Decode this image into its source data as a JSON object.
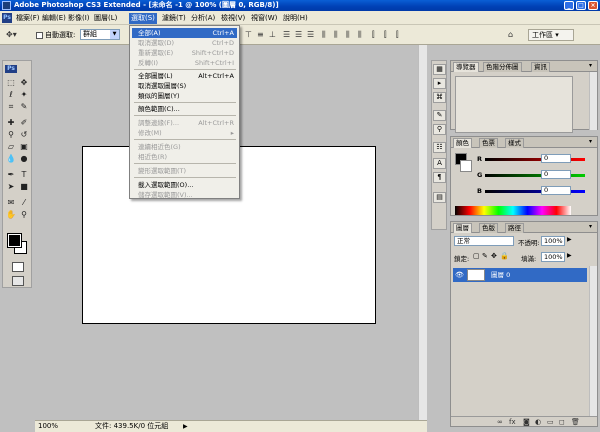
{
  "window": {
    "title": "Adobe Photoshop CS3 Extended - [未命名 -1 @ 100% (圖層 0, RGB/8)]",
    "minimize": "_",
    "maximize": "□",
    "close": "×"
  },
  "menubar": {
    "logo": "Ps",
    "items": [
      "檔案(F)",
      "編輯(E)",
      "影像(I)",
      "圖層(L)",
      "選取(S)",
      "濾鏡(T)",
      "分析(A)",
      "檢視(V)",
      "視窗(W)",
      "說明(H)"
    ]
  },
  "options": {
    "auto_select_label": "自動選取:",
    "select_value": "群組",
    "workspace_label": "工作區 ▾"
  },
  "select_menu": {
    "items": [
      {
        "label": "全部(A)",
        "shortcut": "Ctrl+A",
        "state": "selected"
      },
      {
        "label": "取消選取(D)",
        "shortcut": "Ctrl+D",
        "state": "disabled"
      },
      {
        "label": "重新選取(E)",
        "shortcut": "Shift+Ctrl+D",
        "state": "disabled"
      },
      {
        "label": "反轉(I)",
        "shortcut": "Shift+Ctrl+I",
        "state": "disabled"
      },
      {
        "label": "全部圖層(L)",
        "shortcut": "Alt+Ctrl+A",
        "state": "enabled"
      },
      {
        "label": "取消選取圖層(S)",
        "shortcut": "",
        "state": "enabled"
      },
      {
        "label": "類似的圖層(Y)",
        "shortcut": "",
        "state": "enabled"
      },
      {
        "label": "顏色範圍(C)...",
        "shortcut": "",
        "state": "enabled"
      },
      {
        "label": "調整邊緣(F)...",
        "shortcut": "Alt+Ctrl+R",
        "state": "disabled"
      },
      {
        "label": "修改(M)",
        "shortcut": "▸",
        "state": "disabled"
      },
      {
        "label": "連續相近色(G)",
        "shortcut": "",
        "state": "disabled"
      },
      {
        "label": "相近色(R)",
        "shortcut": "",
        "state": "disabled"
      },
      {
        "label": "變形選取範圍(T)",
        "shortcut": "",
        "state": "disabled"
      },
      {
        "label": "載入選取範圍(O)...",
        "shortcut": "",
        "state": "enabled"
      },
      {
        "label": "儲存選取範圍(V)...",
        "shortcut": "",
        "state": "disabled"
      }
    ]
  },
  "navigator_panel": {
    "tabs": [
      "導覽器",
      "色階分佈圖",
      "資訊"
    ]
  },
  "color_panel": {
    "tabs": [
      "顏色",
      "色票",
      "樣式"
    ],
    "sliders": [
      {
        "label": "R",
        "value": "0",
        "color": "#cc0000"
      },
      {
        "label": "G",
        "value": "0",
        "color": "#00aa00"
      },
      {
        "label": "B",
        "value": "0",
        "color": "#0000cc"
      }
    ]
  },
  "layers_panel": {
    "tabs": [
      "圖層",
      "色版",
      "路徑"
    ],
    "blend_mode": "正常",
    "opacity_label": "不透明:",
    "opacity_value": "100%",
    "lock_label": "鎖定:",
    "fill_label": "填滿:",
    "fill_value": "100%",
    "layers": [
      {
        "name": "圖層 0",
        "visible": true
      }
    ]
  },
  "status": {
    "zoom": "100%",
    "doc_info": "文件: 439.5K/0 位元組"
  }
}
